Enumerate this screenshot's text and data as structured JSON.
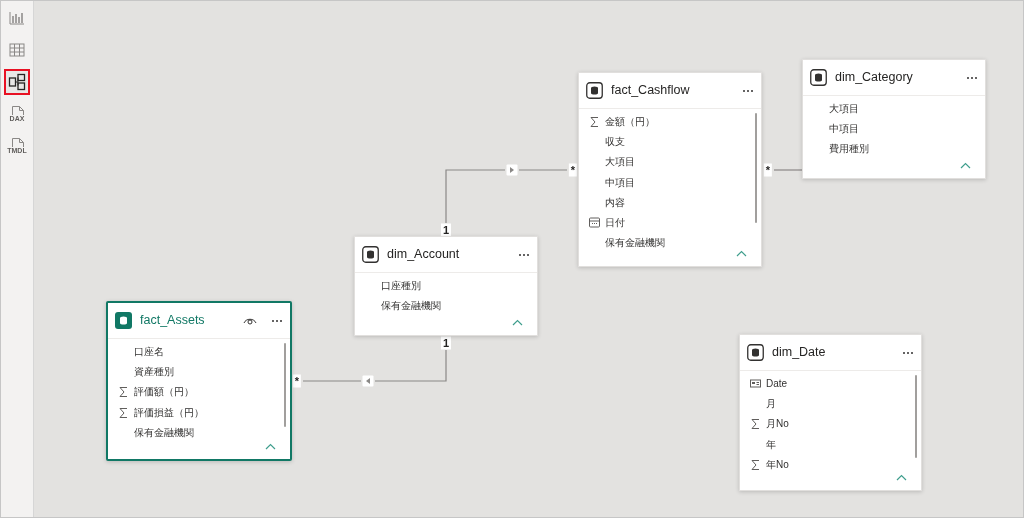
{
  "sidebar": {
    "items": [
      {
        "kind": "report",
        "selected": false
      },
      {
        "kind": "table",
        "selected": false
      },
      {
        "kind": "model",
        "selected": true
      },
      {
        "kind": "dax",
        "label": "DAX",
        "selected": false
      },
      {
        "kind": "tmdl",
        "label": "TMDL",
        "selected": false
      }
    ]
  },
  "tables": [
    {
      "name": "fact_Cashflow",
      "selected": false,
      "fields": [
        {
          "name": "金額（円）",
          "kind": "sum"
        },
        {
          "name": "収支",
          "kind": "plain"
        },
        {
          "name": "大項目",
          "kind": "plain"
        },
        {
          "name": "中項目",
          "kind": "plain"
        },
        {
          "name": "内容",
          "kind": "plain"
        },
        {
          "name": "日付",
          "kind": "date"
        },
        {
          "name": "保有金融機関",
          "kind": "plain"
        }
      ]
    },
    {
      "name": "dim_Category",
      "selected": false,
      "fields": [
        {
          "name": "大項目",
          "kind": "plain"
        },
        {
          "name": "中項目",
          "kind": "plain"
        },
        {
          "name": "費用種別",
          "kind": "plain"
        }
      ]
    },
    {
      "name": "dim_Account",
      "selected": false,
      "fields": [
        {
          "name": "口座種別",
          "kind": "plain"
        },
        {
          "name": "保有金融機関",
          "kind": "plain"
        }
      ]
    },
    {
      "name": "fact_Assets",
      "selected": true,
      "fields": [
        {
          "name": "口座名",
          "kind": "plain"
        },
        {
          "name": "資産種別",
          "kind": "plain"
        },
        {
          "name": "評価額（円）",
          "kind": "sum"
        },
        {
          "name": "評価損益（円）",
          "kind": "sum"
        },
        {
          "name": "保有金融機関",
          "kind": "plain"
        }
      ]
    },
    {
      "name": "dim_Date",
      "selected": false,
      "fields": [
        {
          "name": "Date",
          "kind": "key"
        },
        {
          "name": "月",
          "kind": "plain"
        },
        {
          "name": "月No",
          "kind": "sum"
        },
        {
          "name": "年",
          "kind": "plain"
        },
        {
          "name": "年No",
          "kind": "sum"
        }
      ]
    }
  ],
  "relationships": [
    {
      "many_label": "*",
      "one_label": "1",
      "kind": "right"
    },
    {
      "many_label": "*",
      "one_label": "1",
      "kind": "left"
    },
    {
      "many_label": "*",
      "kind": "plain"
    }
  ]
}
